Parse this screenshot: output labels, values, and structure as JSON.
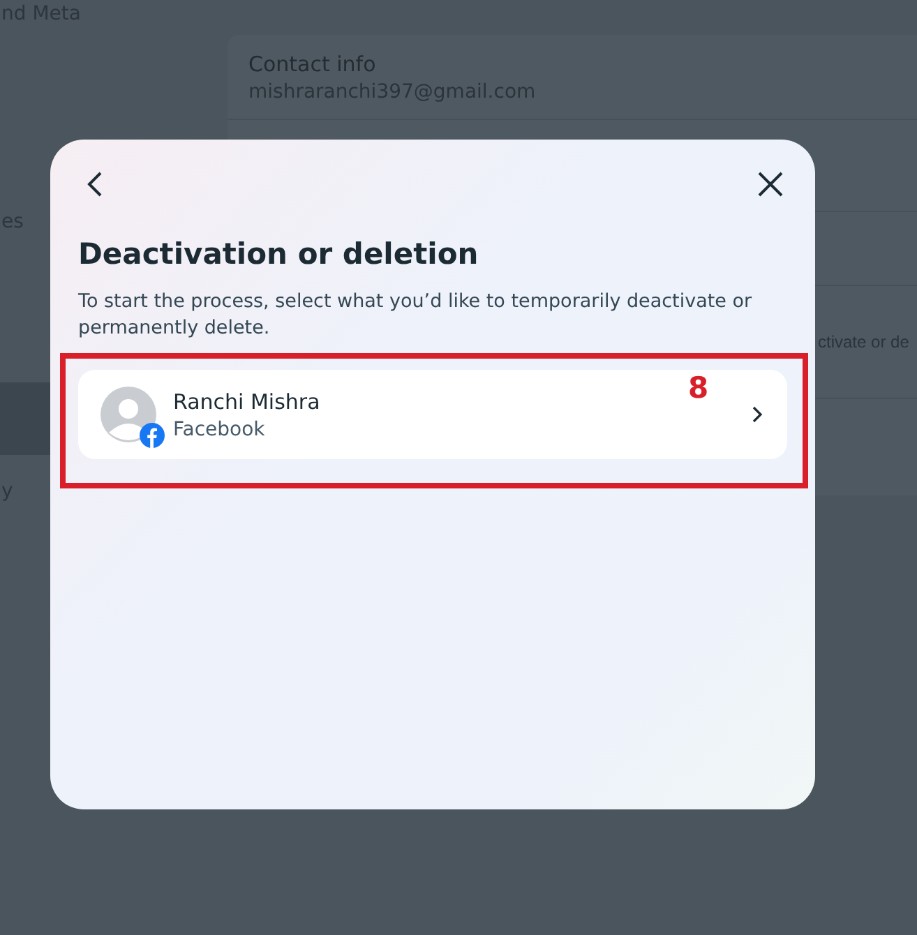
{
  "background": {
    "sidebar": [
      {
        "label": "nd Meta",
        "selected": false
      },
      {
        "label": "es",
        "selected": false
      },
      {
        "selected": true
      },
      {
        "label": "y",
        "selected": false
      }
    ],
    "panel": {
      "rows": [
        {
          "title": "Contact info",
          "value": "mishraranchi397@gmail.com"
        },
        {},
        {},
        {
          "value": "ctivate or de"
        }
      ]
    }
  },
  "dialog": {
    "title": "Deactivation or deletion",
    "description": "To start the process, select what you’d like to temporarily deactivate or permanently delete.",
    "accounts": [
      {
        "name": "Ranchi Mishra",
        "platform": "Facebook"
      }
    ]
  },
  "annotation": {
    "label": "8"
  }
}
